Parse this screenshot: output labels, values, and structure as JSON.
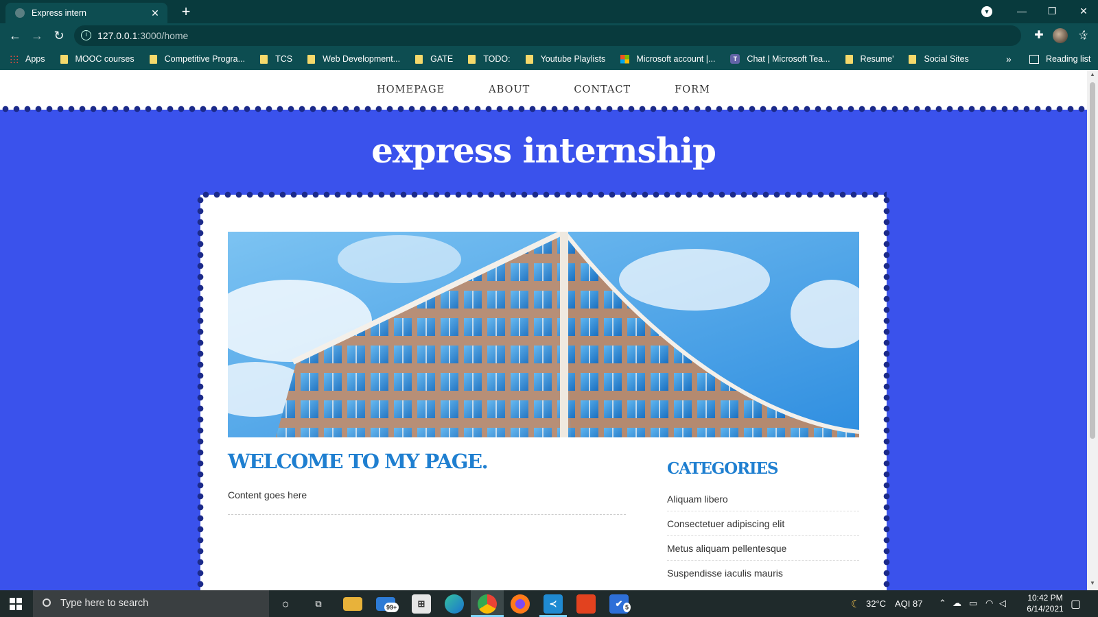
{
  "browser": {
    "tab_title": "Express intern",
    "new_tab_icon": "+",
    "url_host": "127.0.0.1",
    "url_path": ":3000/home",
    "bookmarks": [
      {
        "label": "Apps",
        "icon": "apps"
      },
      {
        "label": "MOOC courses",
        "icon": "folder"
      },
      {
        "label": "Competitive Progra...",
        "icon": "folder"
      },
      {
        "label": "TCS",
        "icon": "folder"
      },
      {
        "label": "Web Development...",
        "icon": "folder"
      },
      {
        "label": "GATE",
        "icon": "folder"
      },
      {
        "label": "TODO:",
        "icon": "folder"
      },
      {
        "label": "Youtube Playlists",
        "icon": "folder"
      },
      {
        "label": "Microsoft account |...",
        "icon": "microsoft"
      },
      {
        "label": "Chat | Microsoft Tea...",
        "icon": "teams"
      },
      {
        "label": "Resume'",
        "icon": "folder"
      },
      {
        "label": "Social Sites",
        "icon": "folder"
      }
    ],
    "bookmarks_more": "»",
    "reading_list": "Reading list"
  },
  "site": {
    "nav": [
      "HOMEPAGE",
      "ABOUT",
      "CONTACT",
      "FORM"
    ],
    "title": "express internship",
    "welcome_heading": "WELCOME TO MY PAGE.",
    "content_text": "Content goes here",
    "categories_heading": "CATEGORIES",
    "categories": [
      "Aliquam libero",
      "Consectetuer adipiscing elit",
      "Metus aliquam pellentesque",
      "Suspendisse iaculis mauris"
    ],
    "colors": {
      "page_background": "#3a52ec",
      "heading_blue": "#1f7fd0",
      "scallop": "#1b2a8a"
    }
  },
  "taskbar": {
    "search_placeholder": "Type here to search",
    "mail_badge": "99+",
    "todo_badge": "5",
    "weather": "32°C",
    "aqi": "AQI 87",
    "time": "10:42 PM",
    "date": "6/14/2021"
  }
}
